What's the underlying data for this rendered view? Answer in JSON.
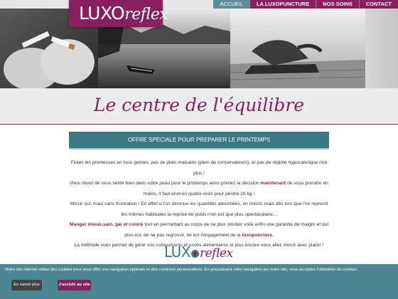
{
  "logo": {
    "word": "LUXO",
    "script": "reflex"
  },
  "nav": {
    "items": [
      {
        "label": "ACCUEIL",
        "active": true
      },
      {
        "label": "LA LUXOPUNCTURE",
        "active": false
      },
      {
        "label": "NOS SOINS",
        "active": false
      },
      {
        "label": "CONTACT",
        "active": false
      }
    ]
  },
  "hero": {
    "photos": [
      "hand-breaking-cigarette",
      "rowboat-on-lake",
      "meditation-pose",
      "grey-panel"
    ]
  },
  "tagline": "Le centre de l'équilibre",
  "offer": {
    "title": "OFFRE SPECIALE POUR PREPARER LE PRINTEMPS"
  },
  "body": {
    "p1": "Finies les promesses en tous genres, pas de plats malsains (plein de conservateurs), et pas de régime hypocalorique non plus !",
    "p2a": "Vous rêvez de vous sentir bien dans votre peau pour le printemps alors prenez la décision ",
    "p2b": "maintenant",
    "p2c": " de vous prendre en mains, il faut environ quatre mois pour perdre 16 kg !",
    "p3": "Mincir oui, mais sans frustration ! En effet si l'on diminue les quantités absorbées, on mincit, mais dès lors que l'on reprend les mêmes habitudes la reprise de poids n'en est que plus spectaculaire...",
    "p4a": "Manger mieux,sain, gai et coloré",
    "p4b": " tout en permettant au corps de ne plus stocker voilà enfin une garantie de maigrir et qui plus est, de ne pas regrossir, tel est l'engagement de la ",
    "p4c": "luxopuncture.",
    "p5": "La méthode vous permet de gérer vos compulsions et excès alimentaires et plus encore vous allez mincir avec plaisir !"
  },
  "bottom_logo": {
    "word_a": "LUX",
    "script": "reflex"
  },
  "cookie": {
    "text": "Notre site internet utilise des cookies pour vous offrir une navigation optimale et des contenus personnalisés. En poursuivant votre navigation sur notre site, vous acceptez l'utilisation de cookies.",
    "more_label": "En savoir plus",
    "accept_label": "J'accède au site"
  },
  "colors": {
    "brand": "#8a1f5e",
    "teal": "#3a7883",
    "cookie_bg": "#4b8893"
  }
}
